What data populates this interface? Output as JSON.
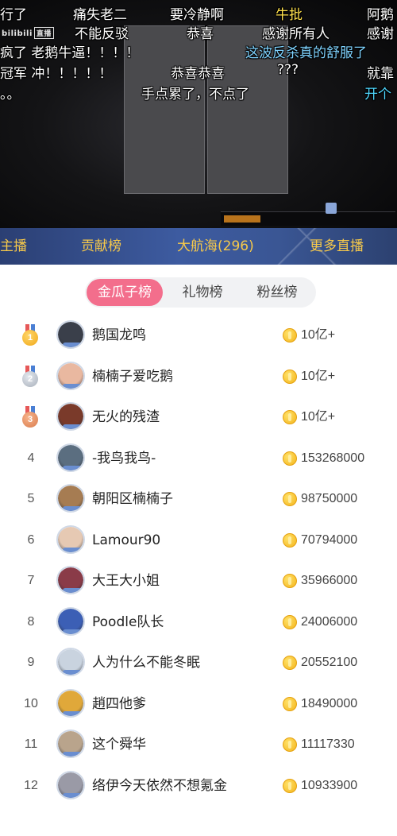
{
  "video": {
    "logo_text": "bilibili",
    "logo_badge": "直播",
    "danmaku": [
      {
        "text": "行了",
        "color": "white"
      },
      {
        "text": "痛失老二",
        "color": "white"
      },
      {
        "text": "要冷静啊",
        "color": "white"
      },
      {
        "text": "牛批",
        "color": "yellow"
      },
      {
        "text": "阿鹅",
        "color": "white"
      },
      {
        "text": "不能反驳",
        "color": "white"
      },
      {
        "text": "恭喜",
        "color": "white"
      },
      {
        "text": "感谢所有人",
        "color": "white"
      },
      {
        "text": "感谢",
        "color": "white"
      },
      {
        "text": "疯了 老鹅牛逼！！！！",
        "color": "white"
      },
      {
        "text": "这波反杀真的舒服了",
        "color": "blue"
      },
      {
        "text": "冠军  冲！！！！！",
        "color": "white"
      },
      {
        "text": "恭喜恭喜",
        "color": "white"
      },
      {
        "text": "???",
        "color": "white"
      },
      {
        "text": "就靠",
        "color": "white"
      },
      {
        "text": "。。",
        "color": "white"
      },
      {
        "text": "手点累了，不点了",
        "color": "white"
      },
      {
        "text": "开个",
        "color": "cyan"
      }
    ]
  },
  "tabs": [
    {
      "label": "主播",
      "active": false
    },
    {
      "label": "贡献榜",
      "active": true
    },
    {
      "label": "大航海(296)",
      "active": false
    },
    {
      "label": "更多直播",
      "active": false
    }
  ],
  "segments": [
    {
      "label": "金瓜子榜",
      "active": true
    },
    {
      "label": "礼物榜",
      "active": false
    },
    {
      "label": "粉丝榜",
      "active": false
    }
  ],
  "ranking": [
    {
      "rank": "1",
      "medal": "gold",
      "name": "鹅国龙鸣",
      "value": "10亿+",
      "avatar_color": "#3a3f4a"
    },
    {
      "rank": "2",
      "medal": "silver",
      "name": "楠楠子爱吃鹅",
      "value": "10亿+",
      "avatar_color": "#e9b8a0"
    },
    {
      "rank": "3",
      "medal": "bronze",
      "name": "无火的残渣",
      "value": "10亿+",
      "avatar_color": "#7a3a2a"
    },
    {
      "rank": "4",
      "medal": "",
      "name": "-我鸟我鸟-",
      "value": "153268000",
      "avatar_color": "#5b6e80"
    },
    {
      "rank": "5",
      "medal": "",
      "name": "朝阳区楠楠子",
      "value": "98750000",
      "avatar_color": "#a67c52"
    },
    {
      "rank": "6",
      "medal": "",
      "name": "Lamour90",
      "value": "70794000",
      "avatar_color": "#e6c9b3"
    },
    {
      "rank": "7",
      "medal": "",
      "name": "大王大小姐",
      "value": "35966000",
      "avatar_color": "#8a3b48"
    },
    {
      "rank": "8",
      "medal": "",
      "name": "Poodle队长",
      "value": "24006000",
      "avatar_color": "#3c5fb5"
    },
    {
      "rank": "9",
      "medal": "",
      "name": "人为什么不能冬眠",
      "value": "20552100",
      "avatar_color": "#c9d3df"
    },
    {
      "rank": "10",
      "medal": "",
      "name": "趙四他爹",
      "value": "18490000",
      "avatar_color": "#e0a83a"
    },
    {
      "rank": "11",
      "medal": "",
      "name": "这个舜华",
      "value": "11117330",
      "avatar_color": "#b9a48c"
    },
    {
      "rank": "12",
      "medal": "",
      "name": "络伊今天依然不想氪金",
      "value": "10933900",
      "avatar_color": "#9a9aa6"
    }
  ]
}
